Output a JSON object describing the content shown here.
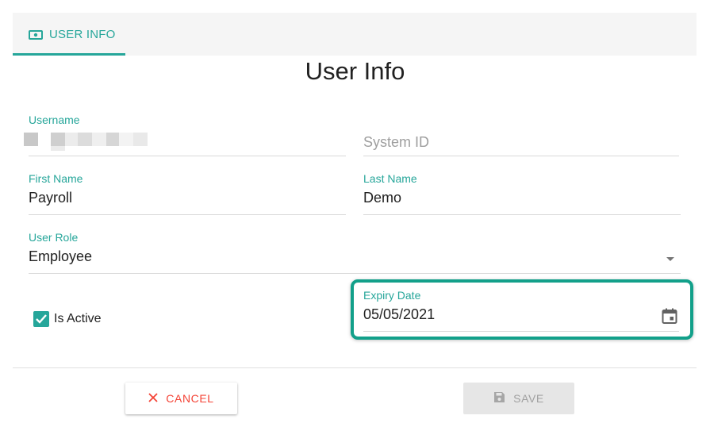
{
  "tabs": [
    {
      "label": "USER INFO",
      "icon": "money-icon",
      "active": true
    }
  ],
  "page_title": "User Info",
  "form": {
    "username": {
      "label": "Username",
      "value": ""
    },
    "system_id": {
      "placeholder": "System ID",
      "value": ""
    },
    "first_name": {
      "label": "First Name",
      "value": "Payroll"
    },
    "last_name": {
      "label": "Last Name",
      "value": "Demo"
    },
    "user_role": {
      "label": "User Role",
      "value": "Employee"
    },
    "is_active": {
      "label": "Is Active",
      "checked": true
    },
    "expiry_date": {
      "label": "Expiry Date",
      "value": "05/05/2021",
      "icon": "calendar-icon"
    }
  },
  "actions": {
    "cancel_label": "CANCEL",
    "save_label": "SAVE"
  },
  "colors": {
    "accent": "#26a69a",
    "highlight": "#12a08a",
    "danger": "#f44336"
  }
}
